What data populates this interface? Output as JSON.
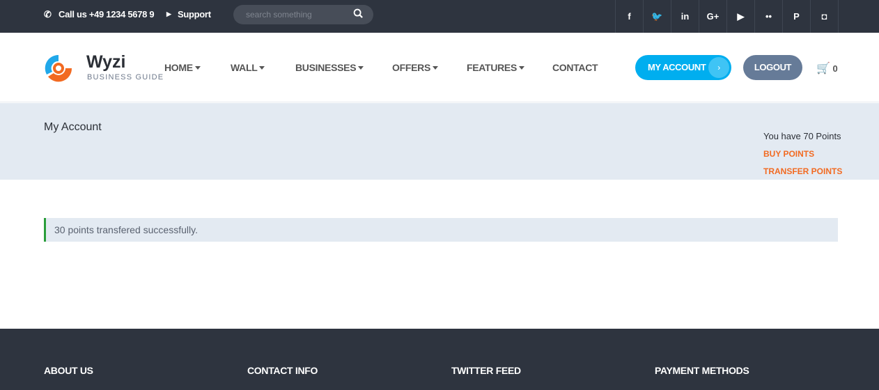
{
  "topbar": {
    "phone": "Call us +49 1234 5678 9",
    "support": "Support",
    "search_placeholder": "search something",
    "social": [
      {
        "icon": "facebook-icon",
        "glyph": "f"
      },
      {
        "icon": "twitter-icon",
        "glyph": "🐦"
      },
      {
        "icon": "linkedin-icon",
        "glyph": "in"
      },
      {
        "icon": "google-plus-icon",
        "glyph": "G+"
      },
      {
        "icon": "youtube-icon",
        "glyph": "▶"
      },
      {
        "icon": "flickr-icon",
        "glyph": "••"
      },
      {
        "icon": "pinterest-icon",
        "glyph": "P"
      },
      {
        "icon": "instagram-icon",
        "glyph": "◘"
      }
    ]
  },
  "header": {
    "brand": "Wyzi",
    "tagline": "BUSINESS GUIDE",
    "nav": [
      {
        "label": "HOME",
        "dropdown": true
      },
      {
        "label": "WALL",
        "dropdown": true
      },
      {
        "label": "BUSINESSES",
        "dropdown": true
      },
      {
        "label": "OFFERS",
        "dropdown": true
      },
      {
        "label": "FEATURES",
        "dropdown": true
      },
      {
        "label": "CONTACT",
        "dropdown": false
      }
    ],
    "my_account": "MY ACCOUNT",
    "logout": "LOGOUT",
    "cart_count": "0"
  },
  "page": {
    "title": "My Account",
    "points_text": "You have 70 Points",
    "buy_points": "BUY POINTS",
    "transfer_points": "TRANSFER POINTS",
    "message": "30 points transfered successfully."
  },
  "footer": {
    "headings": [
      "ABOUT US",
      "CONTACT INFO",
      "TWITTER FEED",
      "PAYMENT METHODS"
    ]
  },
  "colors": {
    "accent": "#00aeef",
    "orange": "#f26a21",
    "dark": "#2e343f",
    "success": "#2a9d3a"
  }
}
